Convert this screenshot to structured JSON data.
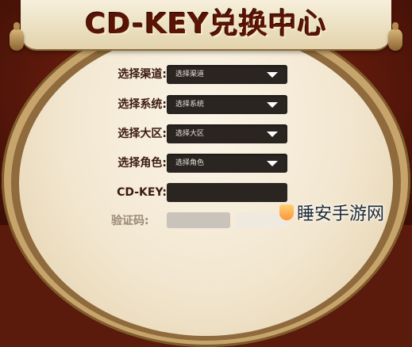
{
  "title": "CD-KEY兑换中心",
  "form": {
    "rows": [
      {
        "label": "选择渠道:",
        "value": "选择渠道"
      },
      {
        "label": "选择系统:",
        "value": "选择系统"
      },
      {
        "label": "选择大区:",
        "value": "选择大区"
      },
      {
        "label": "选择角色:",
        "value": "选择角色"
      }
    ],
    "cdkey_label": "CD-KEY:",
    "cdkey_value": "",
    "captcha_label": "验证码:"
  },
  "watermark": "睡安手游网",
  "colors": {
    "title": "#5a1405",
    "field_bg": "#2a2521",
    "label": "#3a1a10",
    "background": "#5d190b",
    "rim": "#c8a46d"
  }
}
